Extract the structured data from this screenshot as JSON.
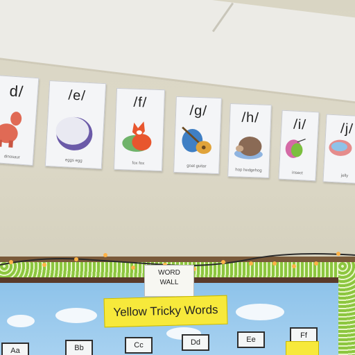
{
  "cards": [
    {
      "sound": "d/",
      "caption": "dinosaur",
      "icon": "dinosaur-icon"
    },
    {
      "sound": "/e/",
      "caption": "eggs egg",
      "icon": "egg-icon"
    },
    {
      "sound": "/f/",
      "caption": "fox fox",
      "icon": "fox-icon"
    },
    {
      "sound": "/g/",
      "caption": "goat guitar",
      "icon": "guitar-icon"
    },
    {
      "sound": "/h/",
      "caption": "hop hedgehog",
      "icon": "hedgehog-icon"
    },
    {
      "sound": "/i/",
      "caption": "insect",
      "icon": "insect-icon"
    },
    {
      "sound": "/j/",
      "caption": "jelly",
      "icon": "jellyfish-icon"
    }
  ],
  "word_wall": {
    "line1": "WORD",
    "line2": "WALL"
  },
  "banner": "Yellow Tricky Words",
  "letters": [
    "Aa",
    "Bb",
    "Cc",
    "Dd",
    "Ee",
    "Ff"
  ],
  "colors": {
    "wall": "#d9d5c3",
    "banner": "#f7e93b",
    "trim": "#8cc63f",
    "sky": "#8ec3ea"
  }
}
